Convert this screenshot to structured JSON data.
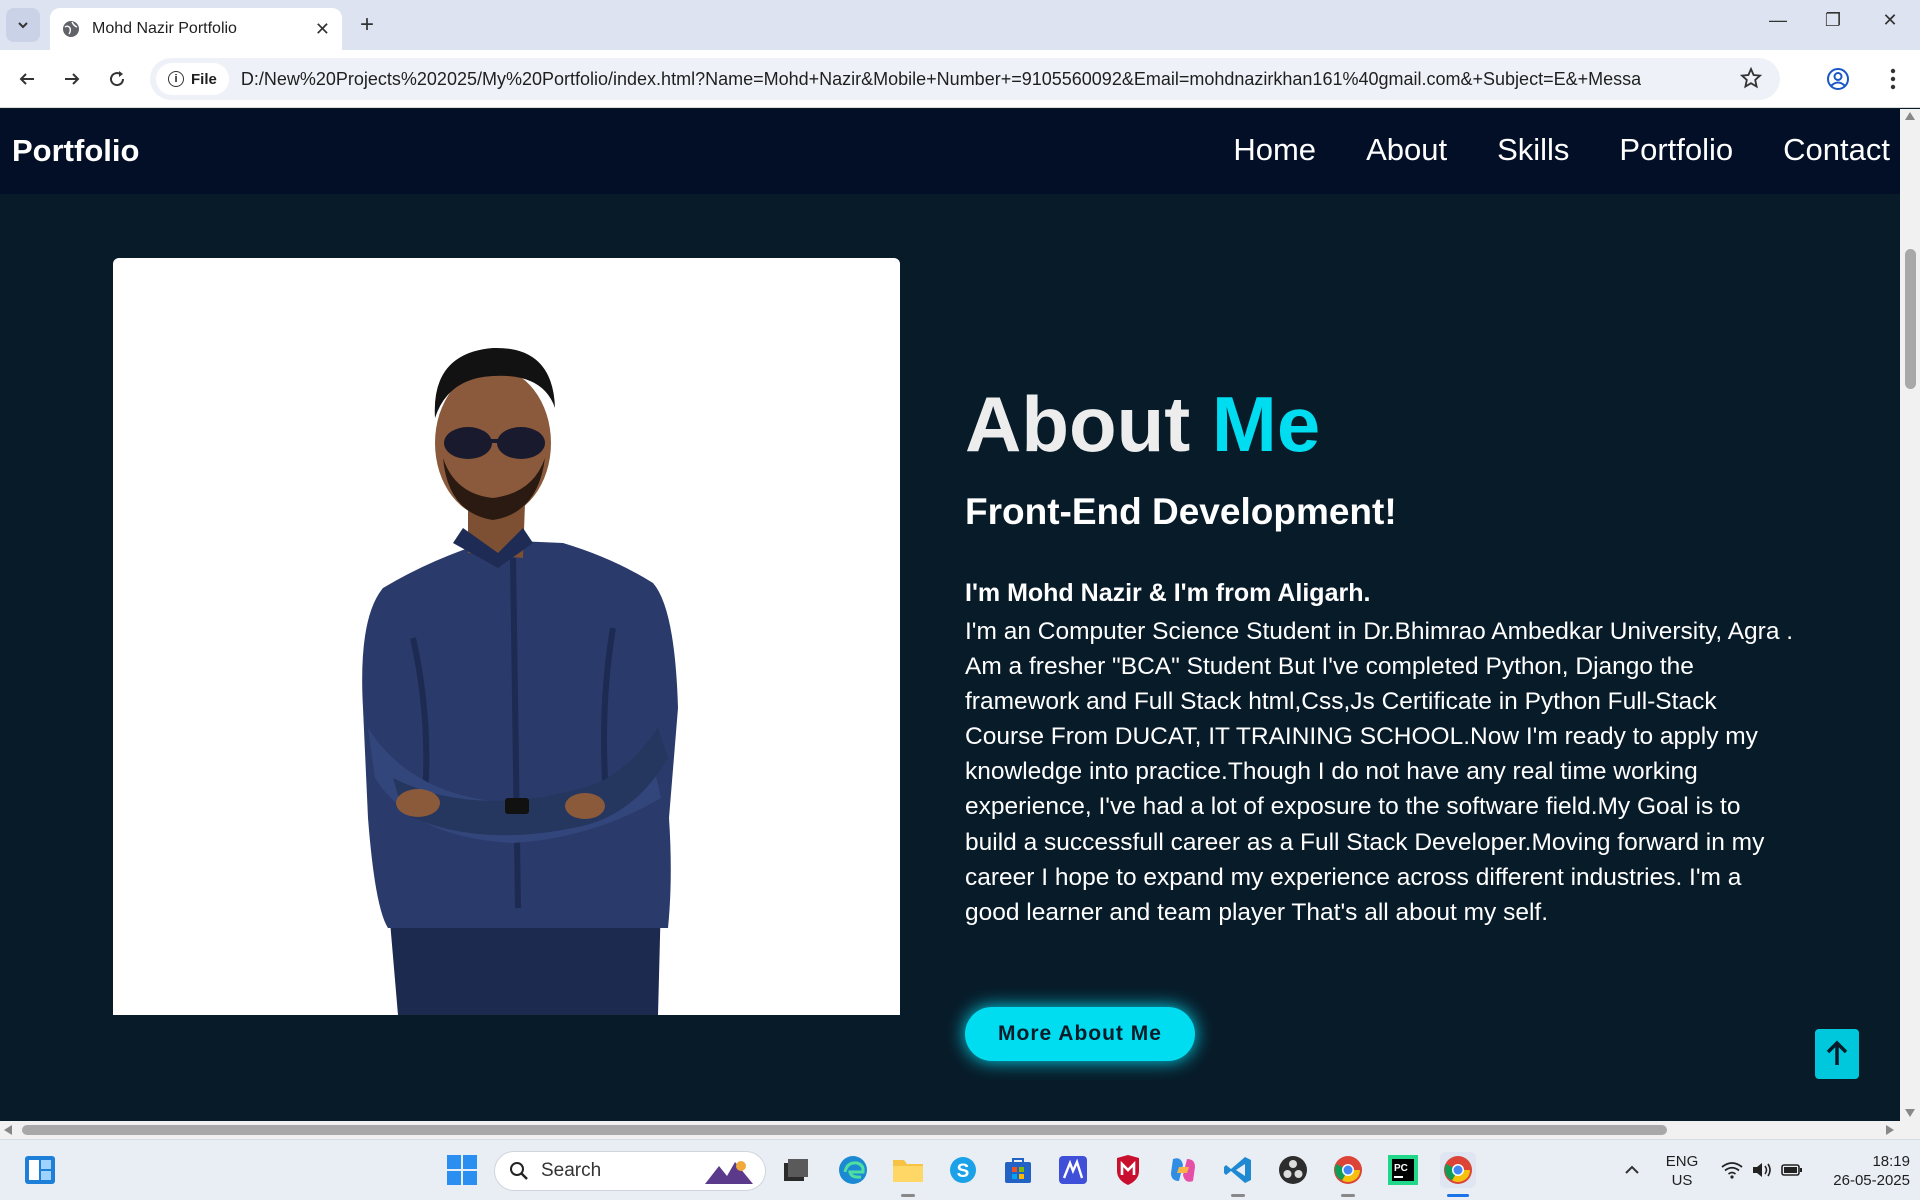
{
  "browser": {
    "tab_title": "Mohd Nazir Portfolio",
    "chip_label": "File",
    "url": "D:/New%20Projects%202025/My%20Portfolio/index.html?Name=Mohd+Nazir&Mobile+Number+=9105560092&Email=mohdnazirkhan161%40gmail.com&+Subject=E&+Message=Hello&_captc..."
  },
  "site": {
    "logo": "Portfolio",
    "nav": [
      "Home",
      "About",
      "Skills",
      "Portfolio",
      "Contact"
    ],
    "about_title_1": "About",
    "about_title_2": "Me",
    "subtitle": "Front-End Development!",
    "intro": "I'm Mohd Nazir & I'm from Aligarh.",
    "body": "I'm an Computer Science Student in Dr.Bhimrao Ambedkar University, Agra . Am a fresher \"BCA\" Student But I've completed Python, Django the framework and Full Stack html,Css,Js Certificate in Python Full-Stack Course From DUCAT, IT TRAINING SCHOOL.Now I'm ready to apply my knowledge into practice.Though I do not have any real time working experience, I've had a lot of exposure to the software field.My Goal is to build a successfull career as a Full Stack Developer.Moving forward in my career I hope to expand my experience across different industries. I'm a good learner and team player That's all about my self.",
    "button": "More About Me",
    "accent_color": "#00dcf0"
  },
  "taskbar": {
    "search_placeholder": "Search",
    "lang_1": "ENG",
    "lang_2": "US",
    "time": "18:19",
    "date": "26-05-2025"
  }
}
